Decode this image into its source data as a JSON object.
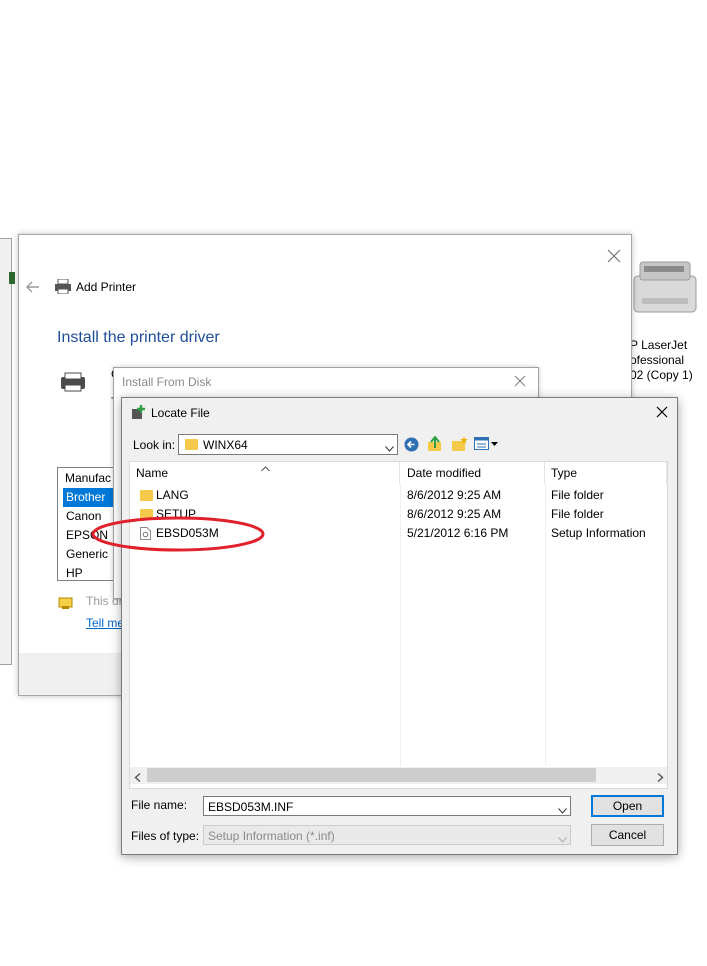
{
  "add_printer": {
    "title": "Add Printer",
    "heading": "Install the printer driver",
    "partial_line1": "C",
    "partial_line2": "T",
    "manufacturer_header": "Manufac",
    "manufacturers": [
      "Brother",
      "Canon",
      "EPSON",
      "Generic",
      "HP"
    ],
    "notice_text": "This dr",
    "tell_me_link": "Tell me"
  },
  "right_printer": {
    "line1": "P LaserJet",
    "line2": "ofessional",
    "line3": "02 (Copy 1)"
  },
  "install_from_disk": {
    "title": "Install From Disk"
  },
  "locate_file": {
    "title": "Locate File",
    "look_in_label": "Look in:",
    "look_in_value": "WINX64",
    "columns": {
      "name": "Name",
      "date": "Date modified",
      "type": "Type"
    },
    "files": [
      {
        "name": "LANG",
        "date": "8/6/2012 9:25 AM",
        "type": "File folder",
        "icon": "folder-icon"
      },
      {
        "name": "SETUP",
        "date": "8/6/2012 9:25 AM",
        "type": "File folder",
        "icon": "folder-icon"
      },
      {
        "name": "EBSD053M",
        "date": "5/21/2012 6:16 PM",
        "type": "Setup Information",
        "icon": "setup-file-icon"
      }
    ],
    "file_name_label": "File name:",
    "file_name_value": "EBSD053M.INF",
    "files_of_type_label": "Files of type:",
    "files_of_type_value": "Setup Information (*.inf)",
    "open_label": "Open",
    "cancel_label": "Cancel"
  },
  "colors": {
    "heading": "#1f4e99",
    "selection": "#0078d7",
    "annotation": "#e0202a"
  }
}
